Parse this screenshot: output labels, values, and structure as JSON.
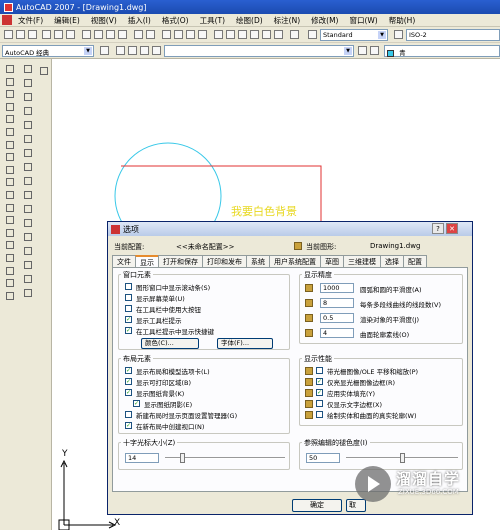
{
  "window": {
    "title": "AutoCAD 2007 - [Drawing1.dwg]"
  },
  "menu": [
    "文件(F)",
    "编辑(E)",
    "视图(V)",
    "插入(I)",
    "格式(O)",
    "工具(T)",
    "绘图(D)",
    "标注(N)",
    "修改(M)",
    "窗口(W)",
    "帮助(H)"
  ],
  "toolbar": {
    "text_style": "Standard",
    "dim_style": "ISO-2",
    "workspace": "AutoCAD 经典",
    "color": "青"
  },
  "canvas": {
    "text": "我要白色背景",
    "axis_x": "X",
    "axis_y": "Y"
  },
  "dialog": {
    "title": "选项",
    "current_profile_label": "当前配置:",
    "current_profile_value": "<<未命名配置>>",
    "current_drawing_label": "当前图形:",
    "current_drawing_value": "Drawing1.dwg",
    "tabs": [
      "文件",
      "显示",
      "打开和保存",
      "打印和发布",
      "系统",
      "用户系统配置",
      "草图",
      "三维建模",
      "选择",
      "配置"
    ],
    "window_elements": {
      "title": "窗口元素",
      "items": [
        {
          "label": "图形窗口中显示滚动条(S)",
          "checked": false
        },
        {
          "label": "显示屏幕菜单(U)",
          "checked": false
        },
        {
          "label": "在工具栏中使用大按钮",
          "checked": false
        },
        {
          "label": "显示工具栏提示",
          "checked": true
        },
        {
          "label": "在工具栏提示中显示快捷键",
          "checked": true
        }
      ],
      "color_button": "颜色(C)...",
      "font_button": "字体(F)..."
    },
    "display_resolution": {
      "title": "显示精度",
      "items": [
        {
          "value": "1000",
          "label": "圆弧和圆的平滑度(A)"
        },
        {
          "value": "8",
          "label": "每条多段线曲线的线段数(V)"
        },
        {
          "value": "0.5",
          "label": "渲染对象的平滑度(J)"
        },
        {
          "value": "4",
          "label": "曲面轮廓素线(O)"
        }
      ]
    },
    "layout_elements": {
      "title": "布局元素",
      "items": [
        {
          "label": "显示布局和模型选项卡(L)",
          "checked": true
        },
        {
          "label": "显示可打印区域(B)",
          "checked": true
        },
        {
          "label": "显示图纸背景(K)",
          "checked": true
        },
        {
          "label": "显示图纸阴影(E)",
          "checked": true
        },
        {
          "label": "新建布局时显示页面设置管理器(G)",
          "checked": false
        },
        {
          "label": "在新布局中创建视口(N)",
          "checked": true
        }
      ]
    },
    "display_performance": {
      "title": "显示性能",
      "items": [
        {
          "label": "带光栅图像/OLE 平移和缩放(P)",
          "checked": false
        },
        {
          "label": "仅亮显光栅图像边框(R)",
          "checked": true
        },
        {
          "label": "应用实体填充(Y)",
          "checked": true
        },
        {
          "label": "仅显示文字边框(X)",
          "checked": false
        },
        {
          "label": "绘制实体和曲面的真实轮廓(W)",
          "checked": false
        }
      ]
    },
    "crosshair": {
      "label": "十字光标大小(Z)",
      "value": "14",
      "slider_fraction": 0.14
    },
    "fade": {
      "label": "参照编辑的褪色度(I)",
      "value": "50",
      "slider_fraction": 0.5
    },
    "ok_label": "确定",
    "cancel_label": "取"
  },
  "watermark": {
    "title": "溜溜自学",
    "subtitle": "ZIXUE.3D66.COM"
  },
  "colors": {
    "accent_tab": "#e68b2c",
    "title_bar": "#1b4bb0",
    "canvas_text": "#e8d820",
    "circle": "#38c8e8",
    "rect": "#e03030"
  }
}
